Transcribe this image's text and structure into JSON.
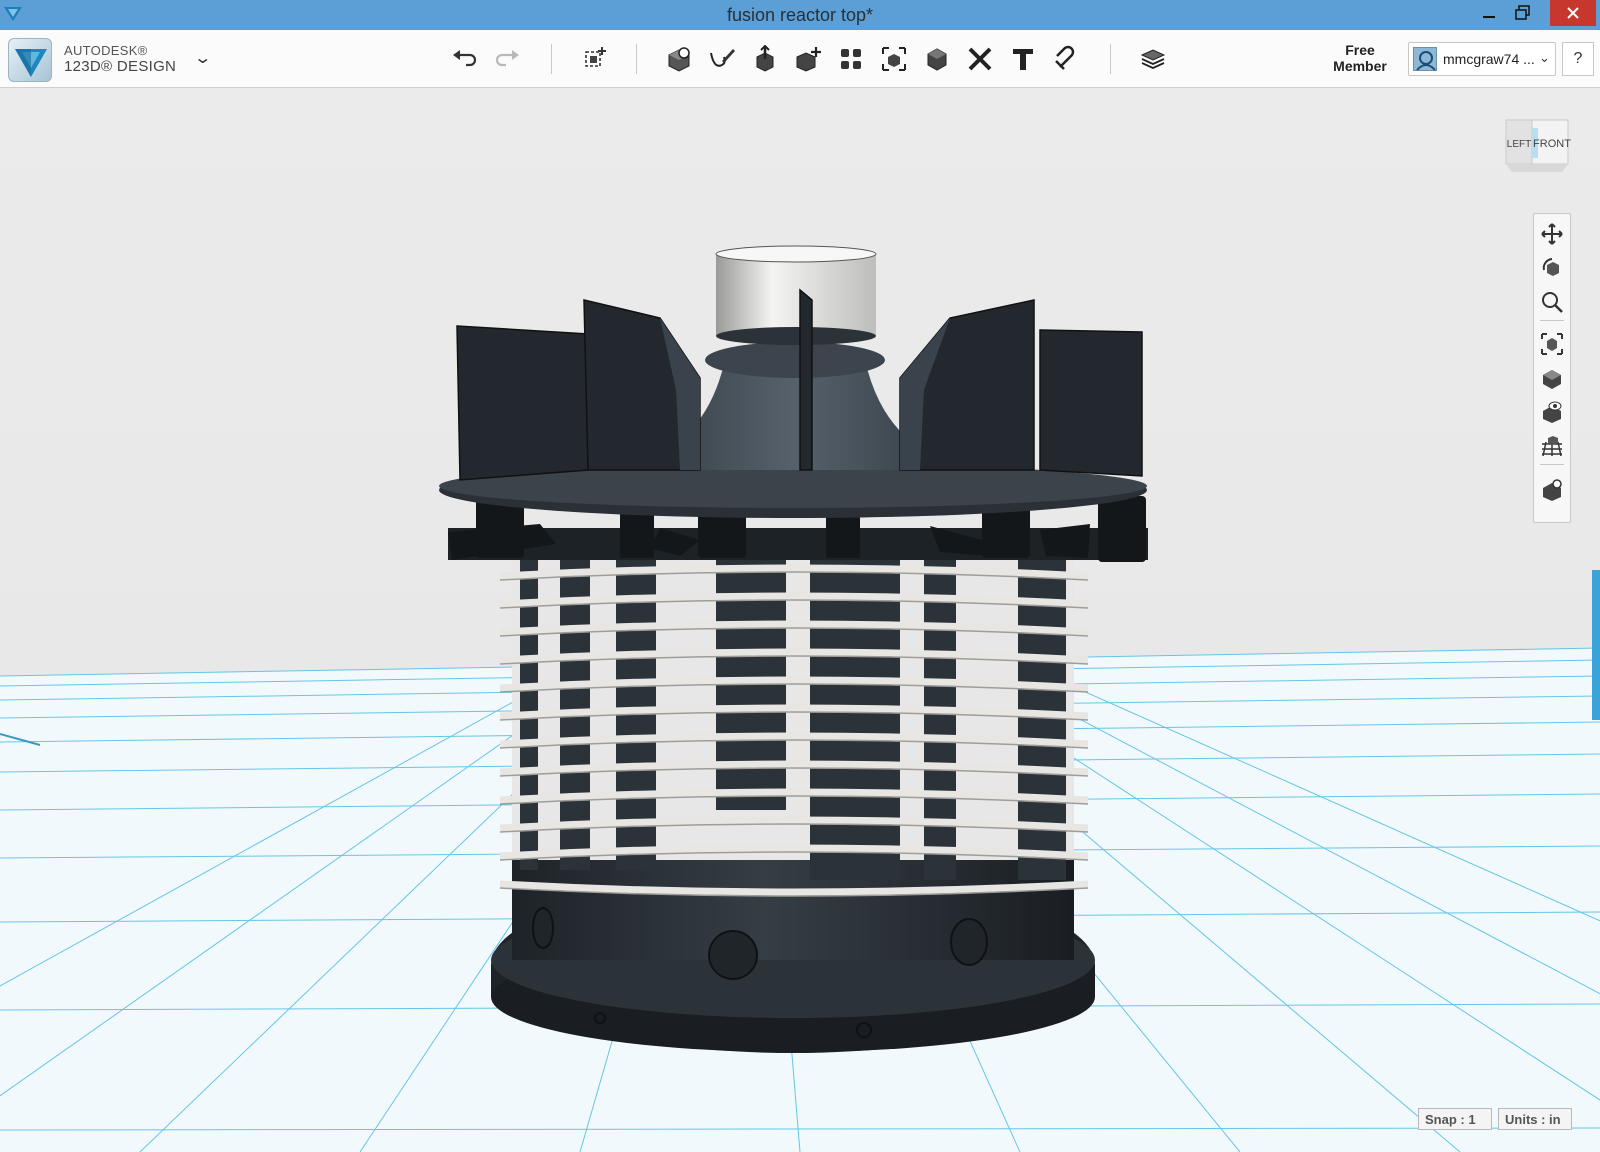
{
  "window": {
    "title": "fusion reactor top*",
    "controls": {
      "minimize": "minimize-icon",
      "maximize": "restore-icon",
      "close": "close-icon"
    }
  },
  "brand": {
    "line1": "AUTODESK®",
    "line2": "123D® DESIGN",
    "menu_icon": "chevron-down-icon"
  },
  "toolbar": {
    "tools": [
      {
        "name": "undo",
        "icon": "undo-icon"
      },
      {
        "name": "redo",
        "icon": "redo-icon"
      },
      {
        "name": "transform",
        "icon": "transform-icon"
      },
      {
        "name": "primitives",
        "icon": "primitives-icon"
      },
      {
        "name": "sketch",
        "icon": "sketch-icon"
      },
      {
        "name": "construct",
        "icon": "construct-icon"
      },
      {
        "name": "modify",
        "icon": "modify-icon"
      },
      {
        "name": "pattern",
        "icon": "pattern-icon"
      },
      {
        "name": "grouping",
        "icon": "grouping-icon"
      },
      {
        "name": "combine",
        "icon": "combine-icon"
      },
      {
        "name": "measure",
        "icon": "measure-icon"
      },
      {
        "name": "text",
        "icon": "text-icon"
      },
      {
        "name": "snap",
        "icon": "snap-icon"
      },
      {
        "name": "materials",
        "icon": "materials-icon"
      }
    ]
  },
  "account": {
    "membership": "Free Member",
    "username": "mmcgraw74 ...",
    "help": "?"
  },
  "viewcube": {
    "left": "LEFT",
    "front": "FRONT"
  },
  "navigation": [
    {
      "name": "pan",
      "icon": "pan-icon"
    },
    {
      "name": "orbit",
      "icon": "orbit-icon"
    },
    {
      "name": "zoom",
      "icon": "zoom-icon"
    },
    {
      "name": "fit",
      "icon": "fit-icon"
    },
    {
      "name": "perspective",
      "icon": "perspective-icon"
    },
    {
      "name": "visibility",
      "icon": "visibility-icon"
    },
    {
      "name": "grid",
      "icon": "grid-icon"
    },
    {
      "name": "material",
      "icon": "material-icon"
    }
  ],
  "status": {
    "snap": "Snap : 1",
    "units": "Units : in"
  },
  "colors": {
    "titlebar": "#5b9fd6",
    "close": "#c7372d",
    "grid": "#56c0e6",
    "model": "#272d33",
    "coil": "#e8e6e3"
  }
}
